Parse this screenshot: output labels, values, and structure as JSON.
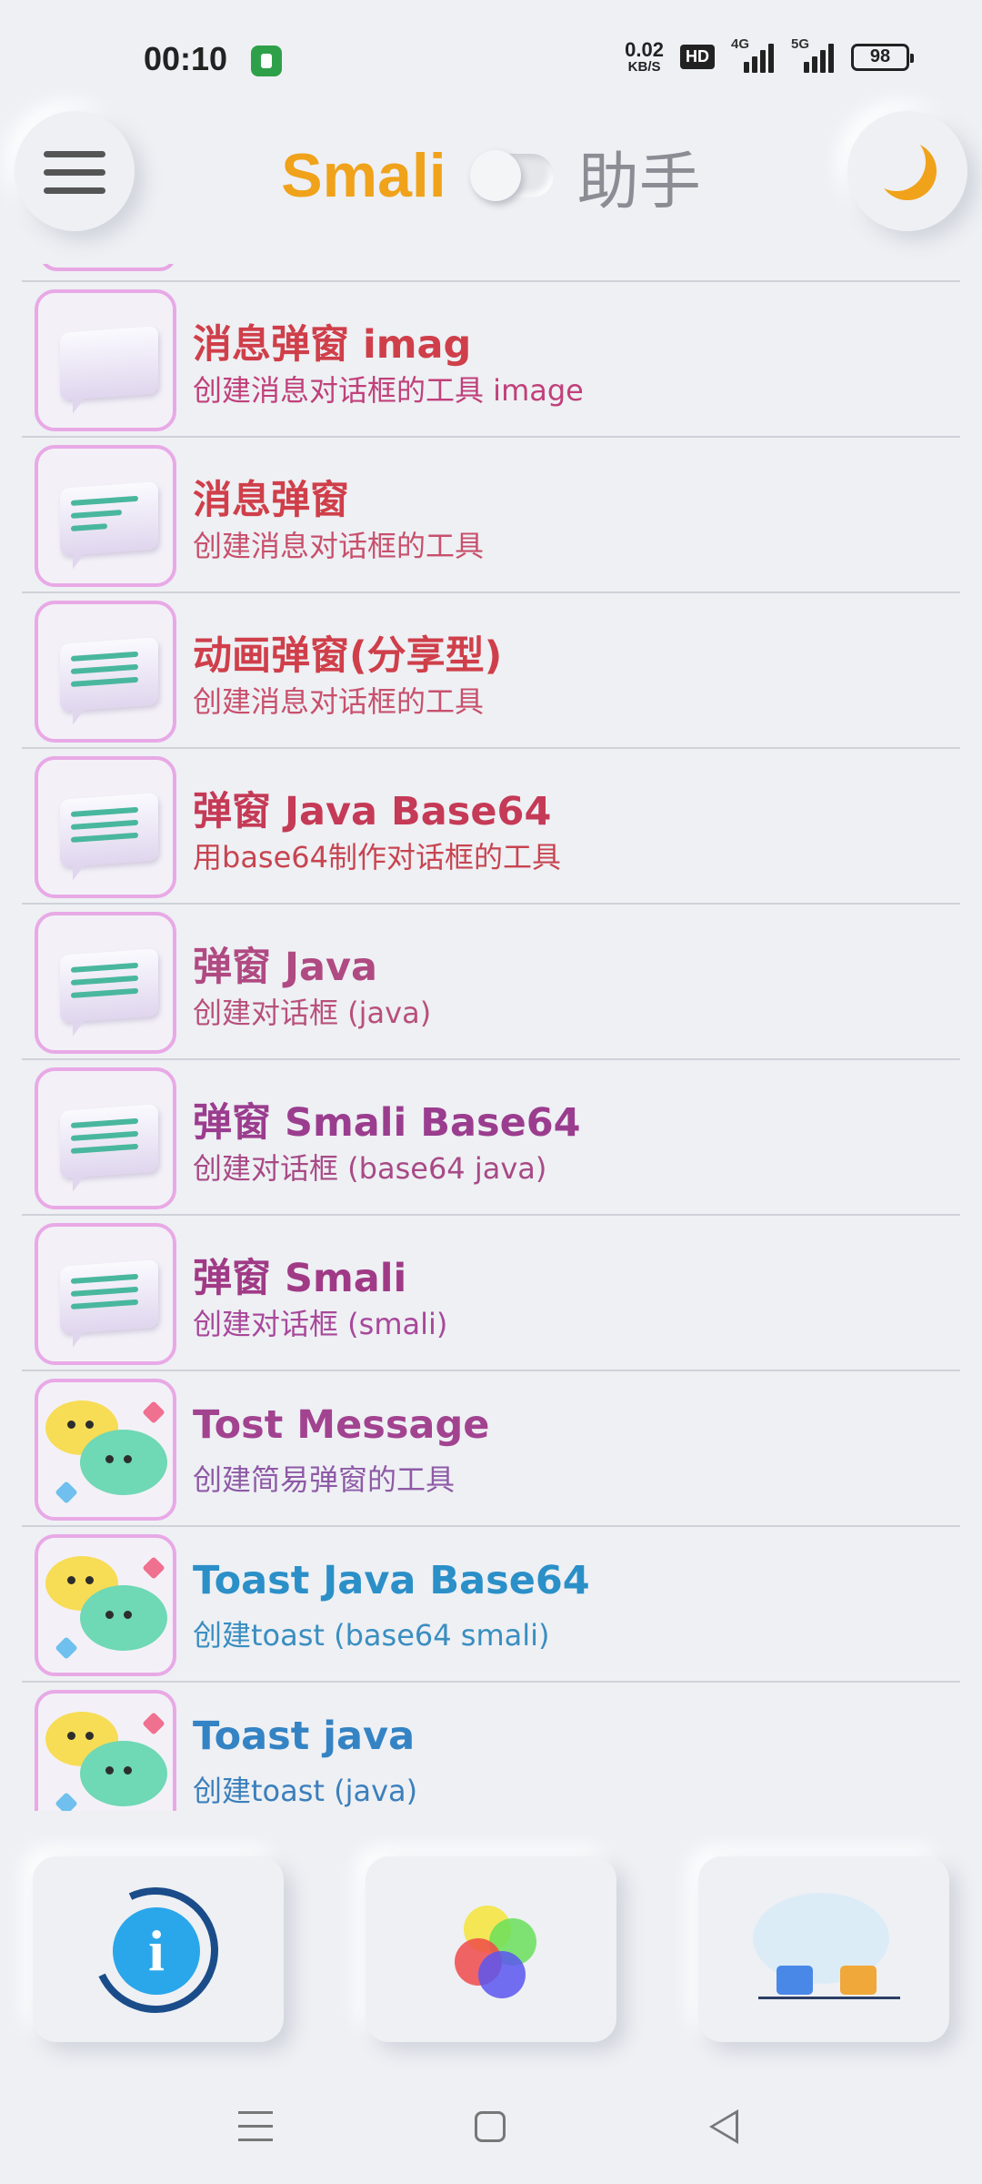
{
  "status_bar": {
    "time": "00:10",
    "net_speed_value": "0.02",
    "net_speed_unit": "KB/S",
    "hd": "HD",
    "signal1": "4G",
    "signal2": "5G",
    "battery": "98"
  },
  "header": {
    "title_left": "Smali",
    "title_right": "助手",
    "menu_icon": "hamburger-icon",
    "theme_icon": "moon-icon",
    "toggle_state": "off"
  },
  "list": {
    "items": [
      {
        "title": "消息弹窗 imag",
        "subtitle": "创建消息对话框的工具 image",
        "icon": "blank-dialog-icon",
        "title_color": "#d64b52",
        "sub_color": "#c0407a"
      },
      {
        "title": "消息弹窗",
        "subtitle": "创建消息对话框的工具",
        "icon": "dialog-icon",
        "title_color": "#cf3f4a",
        "sub_color": "#c8506c"
      },
      {
        "title": "动画弹窗(分享型)",
        "subtitle": "创建消息对话框的工具",
        "icon": "dialog-icon",
        "title_color": "#cf3f4a",
        "sub_color": "#c8506c"
      },
      {
        "title": "弹窗 Java Base64",
        "subtitle": "用base64制作对话框的工具",
        "icon": "dialog-icon",
        "title_color": "#c53a56",
        "sub_color": "#c84450"
      },
      {
        "title": "弹窗 Java",
        "subtitle": "创建对话框 (java)",
        "icon": "dialog-icon",
        "title_color": "#b04a82",
        "sub_color": "#b8507c"
      },
      {
        "title": "弹窗 Smali Base64",
        "subtitle": "创建对话框 (base64 java)",
        "icon": "dialog-icon",
        "title_color": "#9b3d8e",
        "sub_color": "#a84a86"
      },
      {
        "title": "弹窗 Smali",
        "subtitle": "创建对话框 (smali)",
        "icon": "dialog-icon",
        "title_color": "#a03a86",
        "sub_color": "#a8489a"
      },
      {
        "title": "Tost Message",
        "subtitle": "创建简易弹窗的工具",
        "icon": "chat-bubbles-icon",
        "title_color": "#a24390",
        "sub_color": "#8e5aa6"
      },
      {
        "title": "Toast Java Base64",
        "subtitle": "创建toast (base64 smali)",
        "icon": "chat-bubbles-icon",
        "title_color": "#2b8fc8",
        "sub_color": "#3a8ec0"
      },
      {
        "title": "Toast java",
        "subtitle": "创建toast (java)",
        "icon": "chat-bubbles-icon",
        "title_color": "#3483c4",
        "sub_color": "#3c7fbc"
      }
    ]
  },
  "bottom_bar": {
    "info_icon": "info-icon",
    "color_icon": "color-circles-icon",
    "folder_icon": "folders-icon"
  },
  "nav_bar": {
    "menu_icon": "recent-apps-icon",
    "home_icon": "home-icon",
    "back_icon": "back-icon"
  }
}
